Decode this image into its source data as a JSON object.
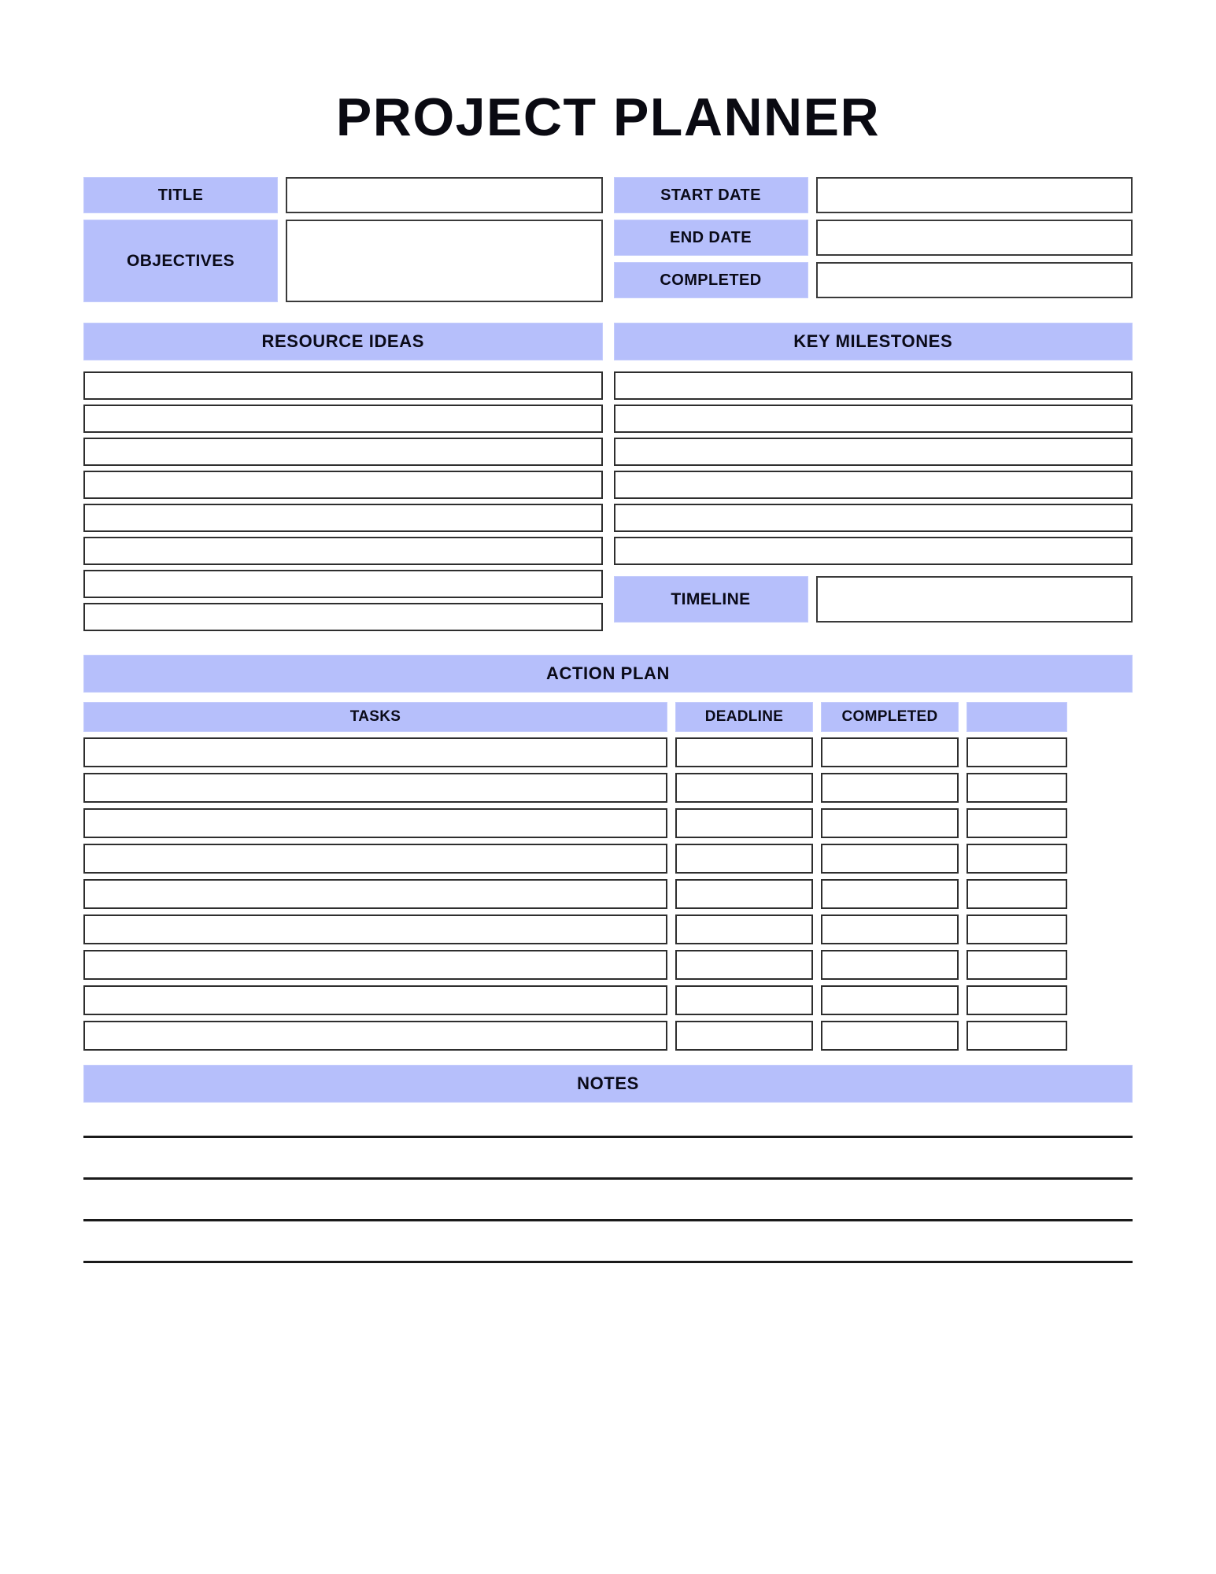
{
  "document": {
    "title": "PROJECT PLANNER"
  },
  "colors": {
    "accent": "#b6bffb",
    "border": "#2e2e2e",
    "text": "#0a0a18",
    "background": "#ffffff"
  },
  "info": {
    "title_label": "TITLE",
    "title_value": "",
    "objectives_label": "OBJECTIVES",
    "objectives_value": "",
    "start_date_label": "START DATE",
    "start_date_value": "",
    "end_date_label": "END DATE",
    "end_date_value": "",
    "completed_label": "COMPLETED",
    "completed_value": ""
  },
  "resource_ideas": {
    "heading": "RESOURCE IDEAS",
    "rows": [
      "",
      "",
      "",
      "",
      "",
      "",
      "",
      ""
    ]
  },
  "key_milestones": {
    "heading": "KEY MILESTONES",
    "rows": [
      "",
      "",
      "",
      "",
      "",
      ""
    ],
    "timeline_label": "TIMELINE",
    "timeline_value": ""
  },
  "action_plan": {
    "heading": "ACTION PLAN",
    "columns": [
      "TASKS",
      "DEADLINE",
      "COMPLETED",
      ""
    ],
    "rows": [
      {
        "task": "",
        "deadline": "",
        "completed": "",
        "check": ""
      },
      {
        "task": "",
        "deadline": "",
        "completed": "",
        "check": ""
      },
      {
        "task": "",
        "deadline": "",
        "completed": "",
        "check": ""
      },
      {
        "task": "",
        "deadline": "",
        "completed": "",
        "check": ""
      },
      {
        "task": "",
        "deadline": "",
        "completed": "",
        "check": ""
      },
      {
        "task": "",
        "deadline": "",
        "completed": "",
        "check": ""
      },
      {
        "task": "",
        "deadline": "",
        "completed": "",
        "check": ""
      },
      {
        "task": "",
        "deadline": "",
        "completed": "",
        "check": ""
      },
      {
        "task": "",
        "deadline": "",
        "completed": "",
        "check": ""
      }
    ]
  },
  "notes": {
    "heading": "NOTES",
    "lines": [
      "",
      "",
      "",
      ""
    ]
  }
}
